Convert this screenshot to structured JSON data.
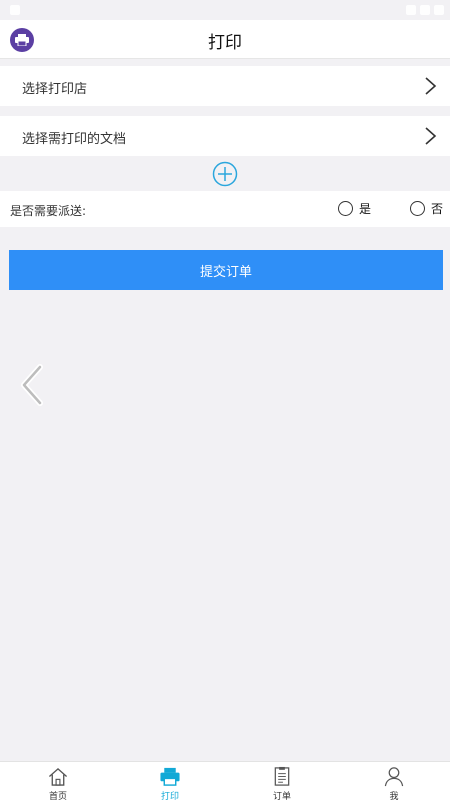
{
  "header": {
    "title": "打印"
  },
  "rows": {
    "select_store": "选择打印店",
    "select_document": "选择需打印的文档"
  },
  "dispatch": {
    "question": "是否需要派送:",
    "yes": "是",
    "no": "否"
  },
  "submit_label": "提交订单",
  "tabs": [
    {
      "label": "首页",
      "icon": "home-icon"
    },
    {
      "label": "打印",
      "icon": "printer-icon",
      "active": true
    },
    {
      "label": "订单",
      "icon": "document-icon"
    },
    {
      "label": "我",
      "icon": "user-icon"
    }
  ],
  "colors": {
    "accent": "#2f8ff7",
    "active_tab": "#12a9d6",
    "logo": "#5b3fa3",
    "background": "#f2f1f4"
  }
}
